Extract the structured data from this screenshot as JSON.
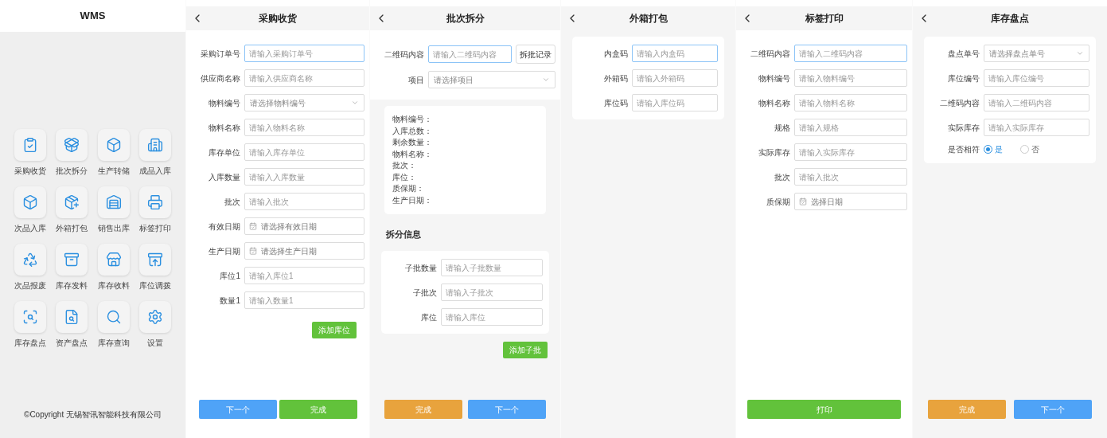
{
  "panels": [
    {
      "kind": "menu",
      "title": "WMS",
      "items": [
        {
          "label": "采购收货"
        },
        {
          "label": "批次拆分"
        },
        {
          "label": "生产转储"
        },
        {
          "label": "成品入库"
        },
        {
          "label": "次品入库"
        },
        {
          "label": "外箱打包"
        },
        {
          "label": "销售出库"
        },
        {
          "label": "标签打印"
        },
        {
          "label": "次品报废"
        },
        {
          "label": "库存发料"
        },
        {
          "label": "库存收料"
        },
        {
          "label": "库位调拨"
        },
        {
          "label": "库存盘点"
        },
        {
          "label": "资产盘点"
        },
        {
          "label": "库存查询"
        },
        {
          "label": "设置"
        }
      ],
      "copyright": "©Copyright 无锡智讯智能科技有限公司"
    },
    {
      "kind": "page",
      "title": "采购收货",
      "sections": [
        {
          "kind": "form",
          "card": false,
          "fields": [
            {
              "kind": "input",
              "label": "采购订单号",
              "placeholder": "请输入采购订单号",
              "focused": true
            },
            {
              "kind": "input",
              "label": "供应商名称",
              "placeholder": "请输入供应商名称",
              "focused": false
            },
            {
              "kind": "select",
              "label": "物料编号",
              "placeholder": "请选择物料编号",
              "focused": false
            },
            {
              "kind": "input",
              "label": "物料名称",
              "placeholder": "请输入物料名称",
              "focused": false
            },
            {
              "kind": "input",
              "label": "库存单位",
              "placeholder": "请输入库存单位",
              "focused": false
            },
            {
              "kind": "input",
              "label": "入库数量",
              "placeholder": "请输入入库数量",
              "focused": false
            },
            {
              "kind": "input",
              "label": "批次",
              "placeholder": "请输入批次",
              "focused": false
            },
            {
              "kind": "date",
              "label": "有效日期",
              "placeholder": "请选择有效日期",
              "focused": false
            },
            {
              "kind": "date",
              "label": "生产日期",
              "placeholder": "请选择生产日期",
              "focused": false
            },
            {
              "kind": "input",
              "label": "库位1",
              "placeholder": "请输入库位1",
              "focused": false
            },
            {
              "kind": "input",
              "label": "数量1",
              "placeholder": "请输入数量1",
              "focused": false
            }
          ]
        },
        {
          "kind": "action",
          "label": "添加库位"
        }
      ],
      "buttons": [
        {
          "label": "下一个",
          "color": "#4fa3f7"
        },
        {
          "label": "完成",
          "color": "#62c23b"
        }
      ]
    },
    {
      "kind": "page",
      "title": "批次拆分",
      "sections": [
        {
          "kind": "form",
          "card": false,
          "fields": [
            {
              "kind": "input",
              "label": "二维码内容",
              "placeholder": "请输入二维码内容",
              "focused": true,
              "side_button": "拆批记录"
            },
            {
              "kind": "select",
              "label": "项目",
              "placeholder": "请选择项目",
              "focused": false
            }
          ]
        },
        {
          "kind": "info",
          "lines": [
            "物料编号：",
            "入库总数：",
            "剩余数量：",
            "物料名称：",
            "批次：",
            "库位：",
            "质保期：",
            "生产日期："
          ]
        },
        {
          "kind": "heading",
          "text": "拆分信息"
        },
        {
          "kind": "form",
          "card": true,
          "fields": [
            {
              "kind": "input",
              "label": "子批数量",
              "placeholder": "请输入子批数量",
              "focused": false
            },
            {
              "kind": "input",
              "label": "子批次",
              "placeholder": "请输入子批次",
              "focused": false
            },
            {
              "kind": "input",
              "label": "库位",
              "placeholder": "请输入库位",
              "focused": false
            }
          ]
        },
        {
          "kind": "action",
          "label": "添加子批"
        }
      ],
      "buttons": [
        {
          "label": "完成",
          "color": "#e8a33d"
        },
        {
          "label": "下一个",
          "color": "#4fa3f7"
        }
      ]
    },
    {
      "kind": "page",
      "title": "外箱打包",
      "sections": [
        {
          "kind": "form",
          "card": true,
          "fields": [
            {
              "kind": "input",
              "label": "内盒码",
              "placeholder": "请输入内盒码",
              "focused": true
            },
            {
              "kind": "input",
              "label": "外箱码",
              "placeholder": "请输入外箱码",
              "focused": false
            },
            {
              "kind": "input",
              "label": "库位码",
              "placeholder": "请输入库位码",
              "focused": false
            }
          ]
        }
      ]
    },
    {
      "kind": "page",
      "title": "标签打印",
      "sections": [
        {
          "kind": "form",
          "card": false,
          "fields": [
            {
              "kind": "input",
              "label": "二维码内容",
              "placeholder": "请输入二维码内容",
              "focused": true
            },
            {
              "kind": "input",
              "label": "物料编号",
              "placeholder": "请输入物料编号",
              "focused": false
            },
            {
              "kind": "input",
              "label": "物料名称",
              "placeholder": "请输入物料名称",
              "focused": false
            },
            {
              "kind": "input",
              "label": "规格",
              "placeholder": "请输入规格",
              "focused": false
            },
            {
              "kind": "input",
              "label": "实际库存",
              "placeholder": "请输入实际库存",
              "focused": false
            },
            {
              "kind": "input",
              "label": "批次",
              "placeholder": "请输入批次",
              "focused": false
            },
            {
              "kind": "date",
              "label": "质保期",
              "placeholder": "选择日期",
              "focused": false
            }
          ]
        }
      ],
      "buttons": [
        {
          "label": "打印",
          "color": "#62c23b"
        }
      ]
    },
    {
      "kind": "page",
      "title": "库存盘点",
      "sections": [
        {
          "kind": "form",
          "card": true,
          "fields": [
            {
              "kind": "select",
              "label": "盘点单号",
              "placeholder": "请选择盘点单号",
              "focused": false
            },
            {
              "kind": "input",
              "label": "库位编号",
              "placeholder": "请输入库位编号",
              "focused": false
            },
            {
              "kind": "input",
              "label": "二维码内容",
              "placeholder": "请输入二维码内容",
              "focused": false
            },
            {
              "kind": "input",
              "label": "实际库存",
              "placeholder": "请输入实际库存",
              "focused": false
            },
            {
              "kind": "radio",
              "label": "是否相符",
              "options": [
                {
                  "label": "是",
                  "selected": true
                },
                {
                  "label": "否",
                  "selected": false
                }
              ]
            }
          ]
        }
      ],
      "buttons": [
        {
          "label": "完成",
          "color": "#e8a33d"
        },
        {
          "label": "下一个",
          "color": "#4fa3f7"
        }
      ]
    }
  ]
}
